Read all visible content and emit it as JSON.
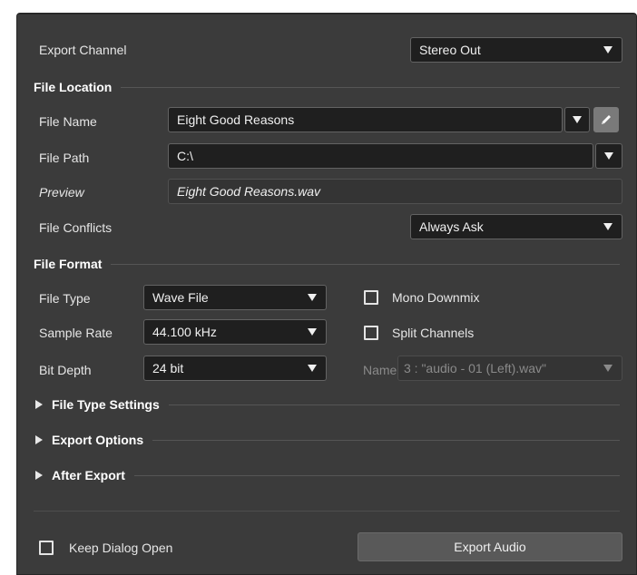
{
  "export_channel": {
    "label": "Export Channel",
    "value": "Stereo Out"
  },
  "file_location": {
    "heading": "File Location",
    "file_name_label": "File Name",
    "file_name_value": "Eight Good Reasons",
    "file_path_label": "File Path",
    "file_path_value": "C:\\",
    "preview_label": "Preview",
    "preview_value": "Eight Good Reasons.wav",
    "file_conflicts_label": "File Conflicts",
    "file_conflicts_value": "Always Ask"
  },
  "file_format": {
    "heading": "File Format",
    "file_type_label": "File Type",
    "file_type_value": "Wave File",
    "sample_rate_label": "Sample Rate",
    "sample_rate_value": "44.100 kHz",
    "bit_depth_label": "Bit Depth",
    "bit_depth_value": "24 bit",
    "mono_downmix_label": "Mono Downmix",
    "mono_downmix_checked": false,
    "split_channels_label": "Split Channels",
    "split_channels_checked": false,
    "name_label": "Name.",
    "name_value": "3 : \"audio - 01 (Left).wav\""
  },
  "collapsed_sections": {
    "file_type_settings": "File Type Settings",
    "export_options": "Export Options",
    "after_export": "After Export"
  },
  "footer": {
    "keep_dialog_open_label": "Keep Dialog Open",
    "keep_dialog_open_checked": false,
    "export_audio_label": "Export Audio"
  },
  "colors": {
    "panel_bg": "#3b3b3b",
    "field_bg": "#1f1f1f",
    "edit_button": "#7a7a7a",
    "export_button": "#595959"
  },
  "icons": {
    "dropdown": "chevron-down-icon",
    "edit": "pencil-icon",
    "expand": "triangle-right-icon"
  }
}
